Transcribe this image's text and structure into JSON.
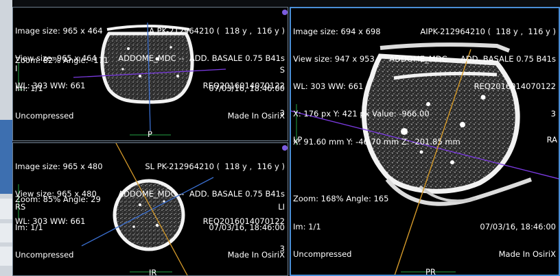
{
  "colors": {
    "active_border": "#4a8fd8",
    "axial_crosshair": "#3a6fd0",
    "coronal_crosshair": "#d59a2a",
    "sagittal_crosshair": "#7a3ae0",
    "ruler": "#23a543"
  },
  "viewports": {
    "axial": {
      "top_left": [
        "Image size: 965 x 464",
        "View size: 965 x 464",
        "WL: 303 WW: 661"
      ],
      "top_right": [
        "A PK-212964210 (  118 y ,  116 y )",
        "ADDOME_MDC --  ADD. BASALE 0.75 B41s",
        "REQ2016014070122",
        "3"
      ],
      "bottom_left": [
        "Zoom: 82% Angle: -171",
        "Im: 1/1",
        "Uncompressed"
      ],
      "bottom_right": [
        "07/03/16, 18:46:00",
        "Made In OsiriX"
      ],
      "orient_left": "I",
      "orient_right": "S",
      "orient_bottom": "P"
    },
    "coronal": {
      "top_left": [
        "Image size: 965 x 480",
        "View size: 965 x 480",
        "WL: 303 WW: 661"
      ],
      "top_right": [
        "SL PK-212964210 (  118 y ,  116 y )",
        "ADDOME_MDC --  ADD. BASALE 0.75 B41s",
        "REQ2016014070122",
        "3"
      ],
      "bottom_left": [
        "Zoom: 85% Angle: 29",
        "Im: 1/1",
        "Uncompressed"
      ],
      "bottom_right": [
        "07/03/16, 18:46:00",
        "Made In OsiriX"
      ],
      "orient_left": "RS",
      "orient_right": "LI",
      "orient_bottom": "IR"
    },
    "sagittal": {
      "top_left": [
        "Image size: 694 x 698",
        "View size: 947 x 953",
        "WL: 303 WW: 661",
        "X: 176 px Y: 421 px Value: -966.00",
        "X: 91.60 mm Y: -46.70 mm Z: -201.85 mm"
      ],
      "top_right": [
        "AIPK-212964210 (  118 y ,  116 y )",
        "ADDOME_MDC --  ADD. BASALE 0.75 B41s",
        "REQ2016014070122",
        "3"
      ],
      "bottom_left": [
        "Zoom: 168% Angle: 165",
        "Im: 1/1",
        "Uncompressed"
      ],
      "bottom_right": [
        "07/03/16, 18:46:00",
        "Made In OsiriX"
      ],
      "orient_left": "LP",
      "orient_right": "RA",
      "orient_bottom": "PR"
    }
  }
}
